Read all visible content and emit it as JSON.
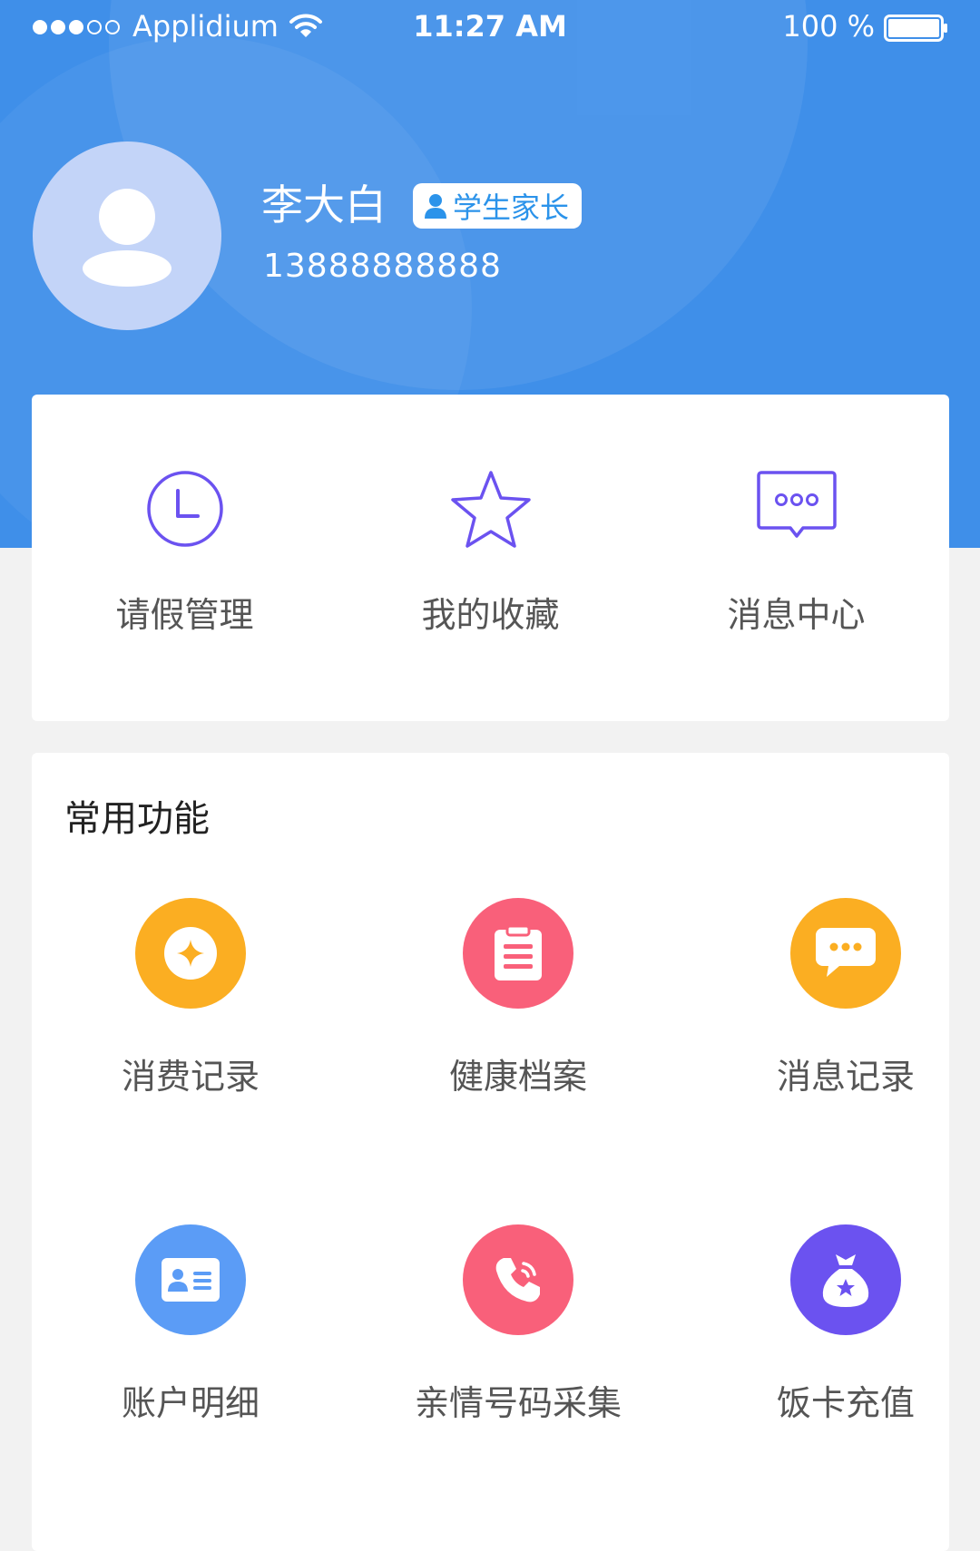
{
  "status_bar": {
    "carrier": "Applidium",
    "time": "11:27 AM",
    "battery": "100 %"
  },
  "profile": {
    "name": "李大白",
    "role": "学生家长",
    "phone": "13888888888"
  },
  "quick_actions": [
    {
      "label": "请假管理",
      "icon": "clock-icon"
    },
    {
      "label": "我的收藏",
      "icon": "star-icon"
    },
    {
      "label": "消息中心",
      "icon": "message-bubble-icon"
    }
  ],
  "common_functions": {
    "title": "常用功能",
    "items": [
      {
        "label": "消费记录",
        "icon": "coin-icon",
        "color": "#fbae22"
      },
      {
        "label": "健康档案",
        "icon": "clipboard-icon",
        "color": "#f9607a"
      },
      {
        "label": "消息记录",
        "icon": "chat-bubble-icon",
        "color": "#fbae22"
      },
      {
        "label": "账户明细",
        "icon": "id-card-icon",
        "color": "#5b9cf6"
      },
      {
        "label": "亲情号码采集",
        "icon": "phone-icon",
        "color": "#f9607a"
      },
      {
        "label": "饭卡充值",
        "icon": "money-bag-icon",
        "color": "#6b52f0"
      }
    ]
  },
  "colors": {
    "header": "#3f8fe9",
    "icon_purple": "#6b52f0",
    "badge_text": "#2b93ea"
  }
}
